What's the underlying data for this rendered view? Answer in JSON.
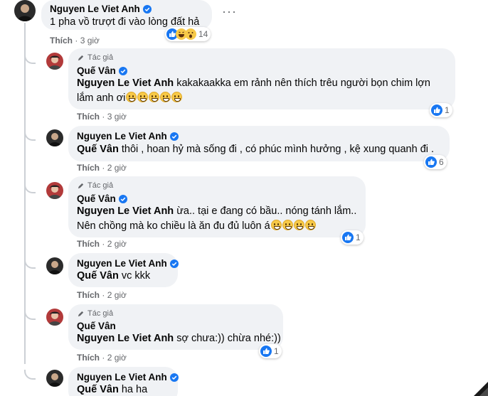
{
  "top_comment": {
    "name": "Nguyen Le Viet Anh",
    "text": "1 pha vồ trượt đi vào lòng đất hả",
    "like_label": "Thích",
    "time": "3 giờ",
    "reaction_count": "14",
    "reaction_icons": [
      "like-icon",
      "haha-icon",
      "wow-icon"
    ],
    "more_icon": "more-options-icon"
  },
  "replies": [
    {
      "author_badge": "Tác giả",
      "name": "Quế Vân",
      "mention": "Nguyen Le Viet Anh",
      "line1": " kakakaakka em rảnh nên thích trêu người bọn chim lợn",
      "line2": "lắm anh ơi",
      "emoji_count": 5,
      "like_label": "Thích",
      "time": "3 giờ",
      "reaction_count": "1"
    },
    {
      "name": "Nguyen Le Viet Anh",
      "mention": "Quế Vân",
      "line1": " thôi , hoan hỷ mà sống đi , có phúc mình hưởng , kệ xung quanh đi .",
      "like_label": "Thích",
      "time": "2 giờ",
      "reaction_count": "6"
    },
    {
      "author_badge": "Tác giả",
      "name": "Quế Vân",
      "mention": "Nguyen Le Viet Anh",
      "line1": " ừa.. tại e đang có bầu.. nóng tánh lắm..",
      "line2": "Nên chồng mà ko chiều là ăn đu đủ luôn á",
      "emoji_count": 4,
      "like_label": "Thích",
      "time": "2 giờ",
      "reaction_count": "1"
    },
    {
      "name": "Nguyen Le Viet Anh",
      "mention": "Quế Vân",
      "line1": " vc kkk",
      "like_label": "Thích",
      "time": "2 giờ"
    },
    {
      "author_badge": "Tác giả",
      "name": "Quế Vân",
      "mention": "Nguyen Le Viet Anh",
      "line1": " sợ chưa:)) chừa nhé:))",
      "like_label": "Thích",
      "time": "2 giờ",
      "reaction_count": "1"
    },
    {
      "name": "Nguyen Le Viet Anh",
      "mention": "Quế Vân",
      "line1": " ha ha"
    }
  ],
  "colors": {
    "verified": "#1877f2",
    "like": "#1877f2",
    "bubble": "#f0f2f5",
    "meta": "#65676b"
  }
}
